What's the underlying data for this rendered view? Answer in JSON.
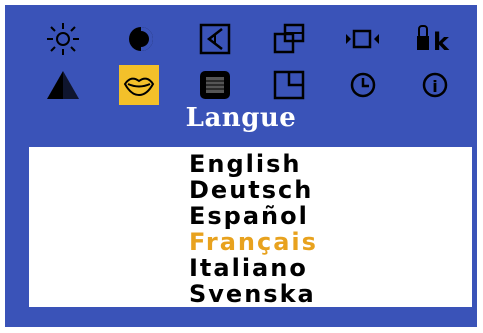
{
  "osd": {
    "background_color": "#3a53b8",
    "highlight_color": "#f3c02a",
    "icons_row1": [
      {
        "name": "brightness-icon"
      },
      {
        "name": "contrast-icon"
      },
      {
        "name": "h-position-icon"
      },
      {
        "name": "size-icon"
      },
      {
        "name": "input-source-icon"
      },
      {
        "name": "lock-icon",
        "text": "k"
      }
    ],
    "icons_row2": [
      {
        "name": "sharpness-icon"
      },
      {
        "name": "language-icon",
        "selected": true
      },
      {
        "name": "color-icon"
      },
      {
        "name": "window-position-icon"
      },
      {
        "name": "timer-icon"
      },
      {
        "name": "info-icon",
        "text": "i"
      }
    ],
    "section_title": "Langue",
    "languages": [
      "English",
      "Deutsch",
      "Español",
      "Français",
      "Italiano",
      "Svenska"
    ],
    "selected_language": "Français",
    "selected_language_color": "#e8a21e"
  }
}
